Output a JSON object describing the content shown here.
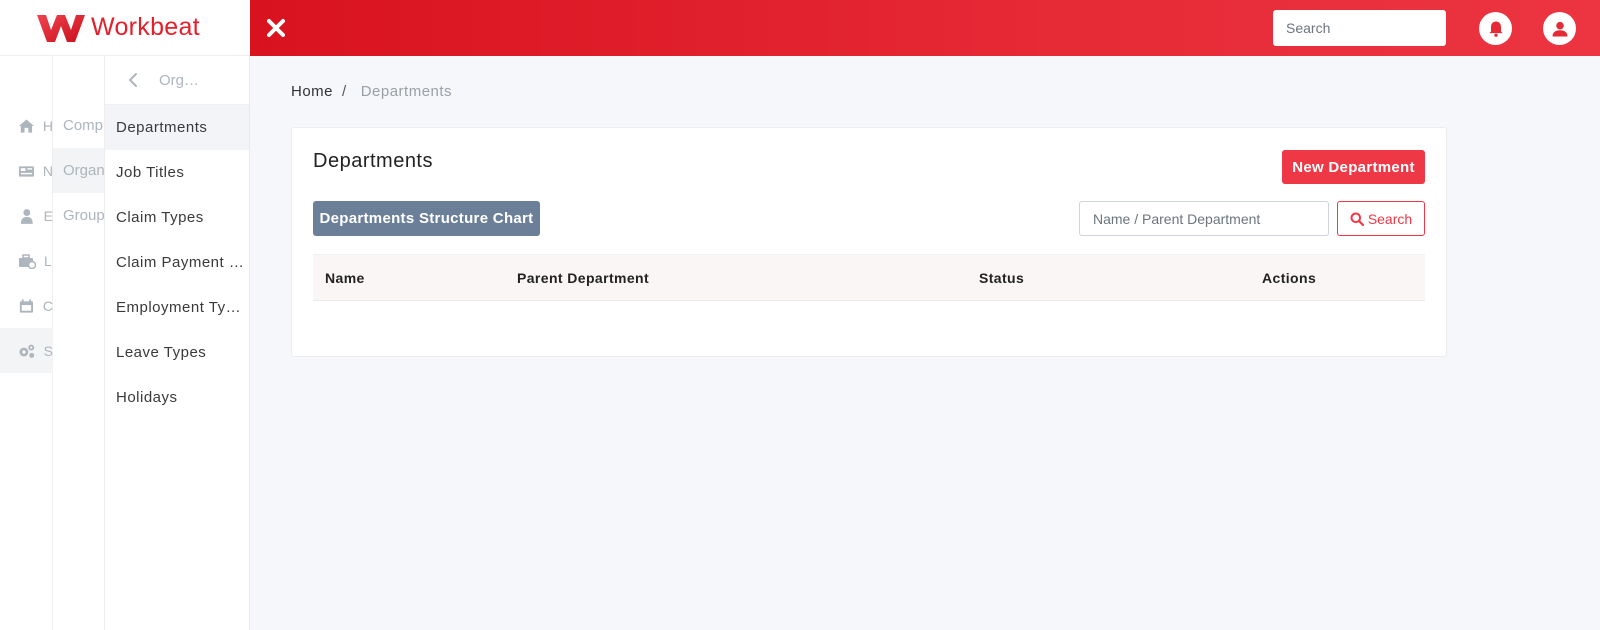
{
  "brand": {
    "name": "Workbeat",
    "color": "#e3202c"
  },
  "topbar": {
    "search_placeholder": "Search",
    "icons": [
      "close-icon",
      "bell-icon",
      "user-icon"
    ]
  },
  "rail": {
    "items": [
      {
        "icon": "home-icon",
        "label": "H"
      },
      {
        "icon": "news-icon",
        "label": "N"
      },
      {
        "icon": "employee-icon",
        "label": "E"
      },
      {
        "icon": "leave-icon",
        "label": "L"
      },
      {
        "icon": "calendar-icon",
        "label": "C"
      },
      {
        "icon": "settings-icon",
        "label": "S"
      }
    ]
  },
  "rail2": {
    "items": [
      {
        "label": "Comp"
      },
      {
        "label": "Organ"
      },
      {
        "label": "Group"
      }
    ]
  },
  "subnav": {
    "title": "Org…",
    "items": [
      {
        "label": "Departments"
      },
      {
        "label": "Job Titles"
      },
      {
        "label": "Claim Types"
      },
      {
        "label": "Claim Payment …"
      },
      {
        "label": "Employment Ty…"
      },
      {
        "label": "Leave Types"
      },
      {
        "label": "Holidays"
      }
    ]
  },
  "breadcrumb": {
    "home": "Home",
    "separator": "/",
    "current": "Departments"
  },
  "card": {
    "title": "Departments",
    "new_button": "New Department",
    "chart_button": "Departments Structure Chart",
    "filter_placeholder": "Name / Parent Department",
    "search_button": "Search"
  },
  "table": {
    "columns": [
      "Name",
      "Parent Department",
      "Status",
      "Actions"
    ],
    "rows": []
  },
  "colors": {
    "accent": "#ef3846",
    "topbar": "#e0202c",
    "secondary_button": "#6c7f99"
  }
}
